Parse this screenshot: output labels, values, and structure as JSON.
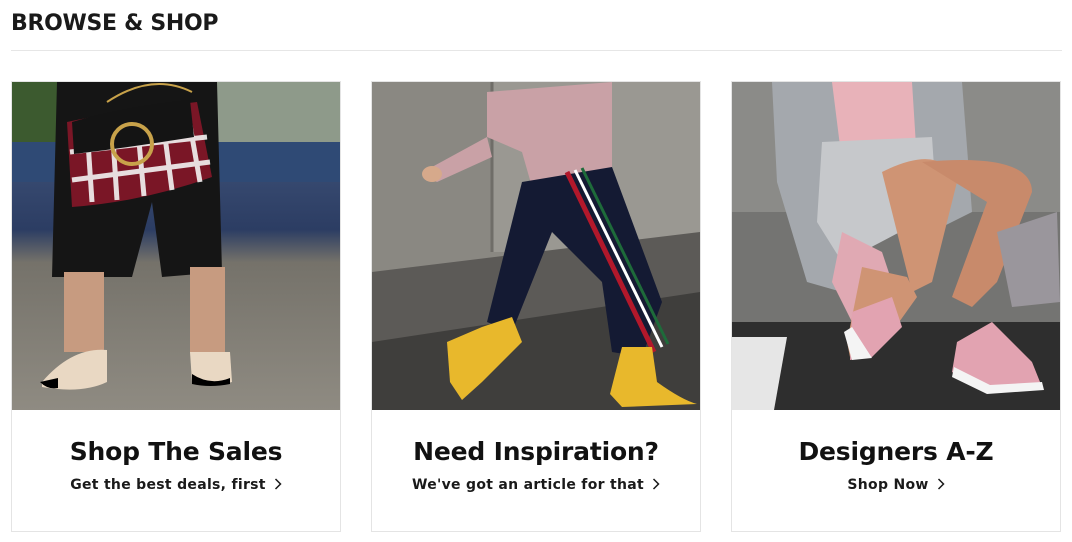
{
  "section": {
    "title": "BROWSE & SHOP"
  },
  "cards": [
    {
      "heading": "Shop The Sales",
      "cta": "Get the best deals, first",
      "icon": "chevron-right-icon"
    },
    {
      "heading": "Need Inspiration?",
      "cta": "We've got an article for that",
      "icon": "chevron-right-icon"
    },
    {
      "heading": "Designers A-Z",
      "cta": "Shop Now",
      "icon": "chevron-right-icon"
    }
  ]
}
